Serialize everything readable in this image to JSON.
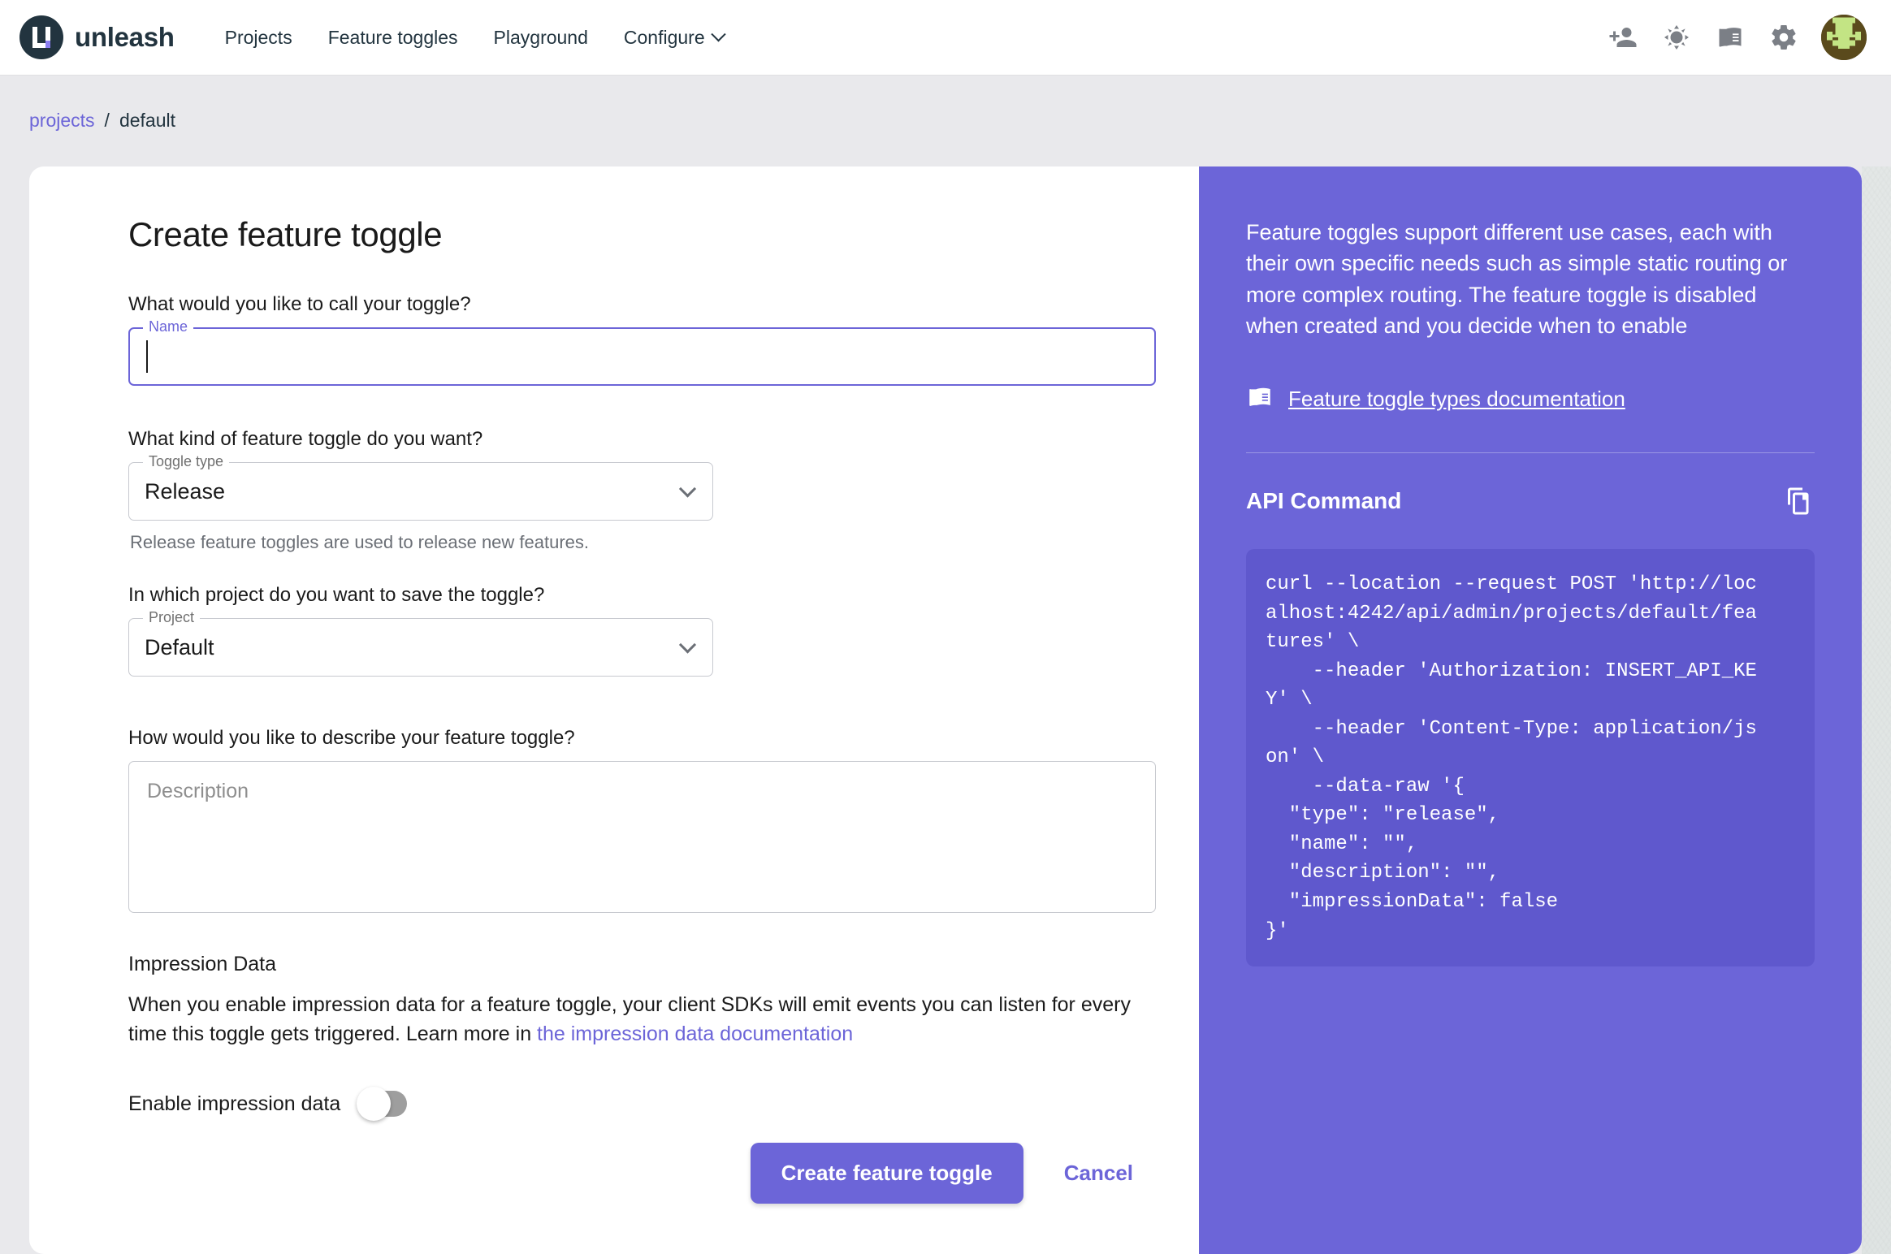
{
  "header": {
    "brand": "unleash",
    "logo_icon": "unleash-logo-icon",
    "nav": [
      {
        "label": "Projects",
        "name": "nav-projects"
      },
      {
        "label": "Feature toggles",
        "name": "nav-feature-toggles"
      },
      {
        "label": "Playground",
        "name": "nav-playground"
      },
      {
        "label": "Configure",
        "name": "nav-configure",
        "has_chevron": true
      }
    ],
    "icons": [
      {
        "name": "add-person-icon"
      },
      {
        "name": "light-mode-icon"
      },
      {
        "name": "documentation-book-icon"
      },
      {
        "name": "settings-gear-icon"
      },
      {
        "name": "user-avatar"
      }
    ]
  },
  "breadcrumb": {
    "root": "projects",
    "separator": "/",
    "current": "default"
  },
  "form": {
    "title": "Create feature toggle",
    "name_question": "What would you like to call your toggle?",
    "name_label": "Name",
    "name_value": "",
    "type_question": "What kind of feature toggle do you want?",
    "type_label": "Toggle type",
    "type_value": "Release",
    "type_helper": "Release feature toggles are used to release new features.",
    "project_question": "In which project do you want to save the toggle?",
    "project_label": "Project",
    "project_value": "Default",
    "description_question": "How would you like to describe your feature toggle?",
    "description_placeholder": "Description",
    "description_value": "",
    "impression_title": "Impression Data",
    "impression_body_1": "When you enable impression data for a feature toggle, your client SDKs will emit events you can listen for every time this toggle gets triggered. Learn more in ",
    "impression_link": "the impression data documentation",
    "impression_toggle_label": "Enable impression data",
    "impression_enabled": false,
    "submit_label": "Create feature toggle",
    "cancel_label": "Cancel"
  },
  "side": {
    "intro": "Feature toggles support different use cases, each with their own specific needs such as simple static routing or more complex routing. The feature toggle is disabled when created and you decide when to enable",
    "doc_link_label": "Feature toggle types documentation",
    "doc_link_icon": "book-icon",
    "api_title": "API Command",
    "copy_icon": "copy-icon",
    "code": "curl --location --request POST 'http://loc\nalhost:4242/api/admin/projects/default/fea\ntures' \\\n    --header 'Authorization: INSERT_API_KE\nY' \\\n    --header 'Content-Type: application/js\non' \\\n    --data-raw '{\n  \"type\": \"release\",\n  \"name\": \"\",\n  \"description\": \"\",\n  \"impressionData\": false\n}'"
  },
  "colors": {
    "accent": "#6c65d8",
    "code_bg": "#5f58cd",
    "page_bg": "#e9e9ec",
    "header_bg": "#ffffff",
    "dark": "#22343f"
  }
}
